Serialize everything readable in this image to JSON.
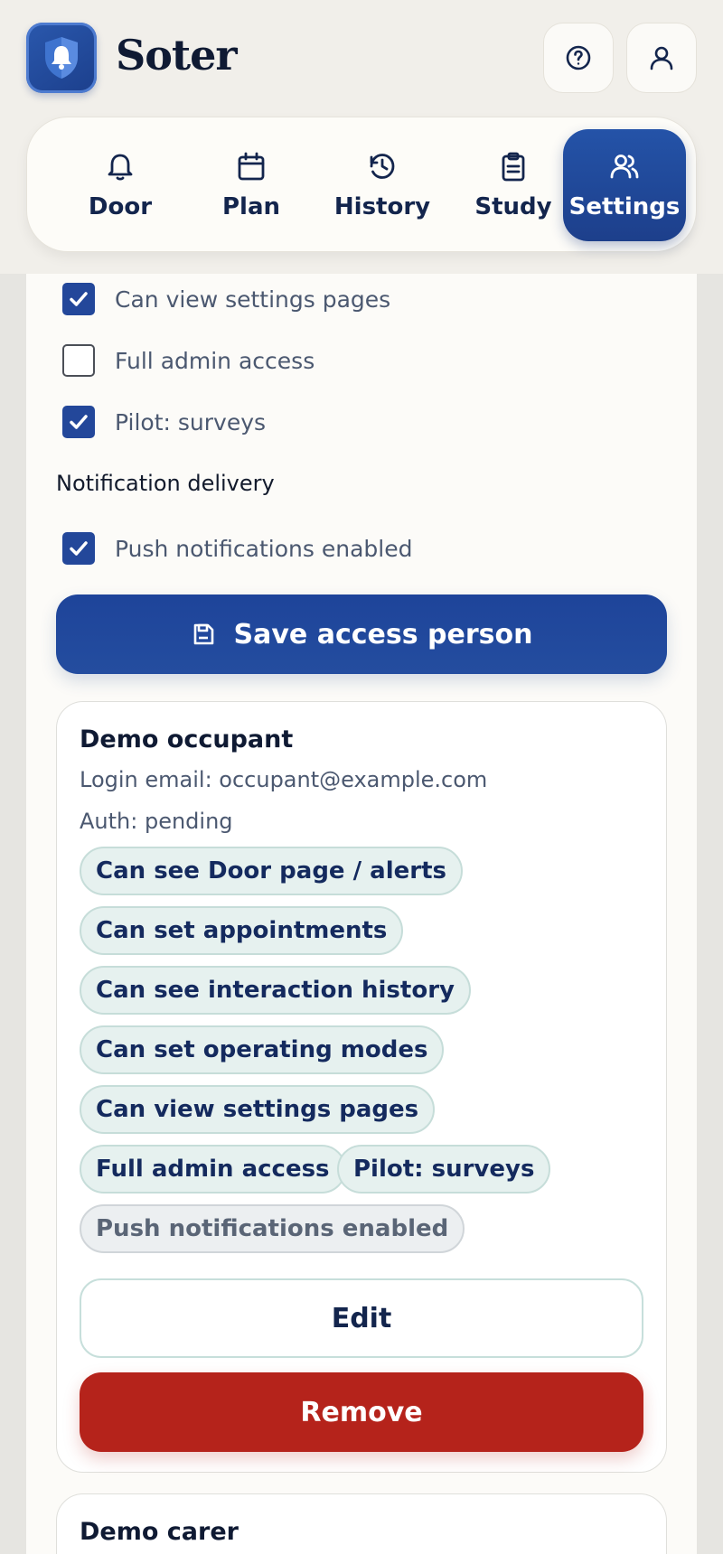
{
  "app": {
    "name": "Soter",
    "logo_icon": "bell-shield-icon",
    "help_icon": "help-circle-icon",
    "profile_icon": "user-icon"
  },
  "nav": {
    "items": [
      {
        "label": "Door",
        "icon": "bell-icon",
        "active": false
      },
      {
        "label": "Plan",
        "icon": "calendar-icon",
        "active": false
      },
      {
        "label": "History",
        "icon": "history-icon",
        "active": false
      },
      {
        "label": "Study",
        "icon": "clipboard-icon",
        "active": false
      },
      {
        "label": "Settings",
        "icon": "users-icon",
        "active": true
      }
    ]
  },
  "permissions": [
    {
      "label": "Can view settings pages",
      "checked": true
    },
    {
      "label": "Full admin access",
      "checked": false
    },
    {
      "label": "Pilot: surveys",
      "checked": true
    }
  ],
  "notification_section": {
    "title": "Notification delivery",
    "options": [
      {
        "label": "Push notifications enabled",
        "checked": true
      }
    ]
  },
  "save_button": {
    "label": "Save access person",
    "icon": "save-icon"
  },
  "people": [
    {
      "name": "Demo occupant",
      "login_email_line": "Login email: occupant@example.com",
      "auth_line": "Auth: pending",
      "chips": [
        "Can see Door page / alerts",
        "Can set appointments",
        "Can see interaction history",
        "Can set operating modes",
        "Can view settings pages",
        "Full admin access",
        "Pilot: surveys"
      ],
      "muted_chip": "Push notifications enabled",
      "edit_label": "Edit",
      "remove_label": "Remove"
    },
    {
      "name": "Demo carer"
    }
  ],
  "colors": {
    "primary": "#23479a",
    "danger": "#b5231b",
    "chip_bg": "#e6f1ef",
    "page_bg": "#f1efea"
  }
}
